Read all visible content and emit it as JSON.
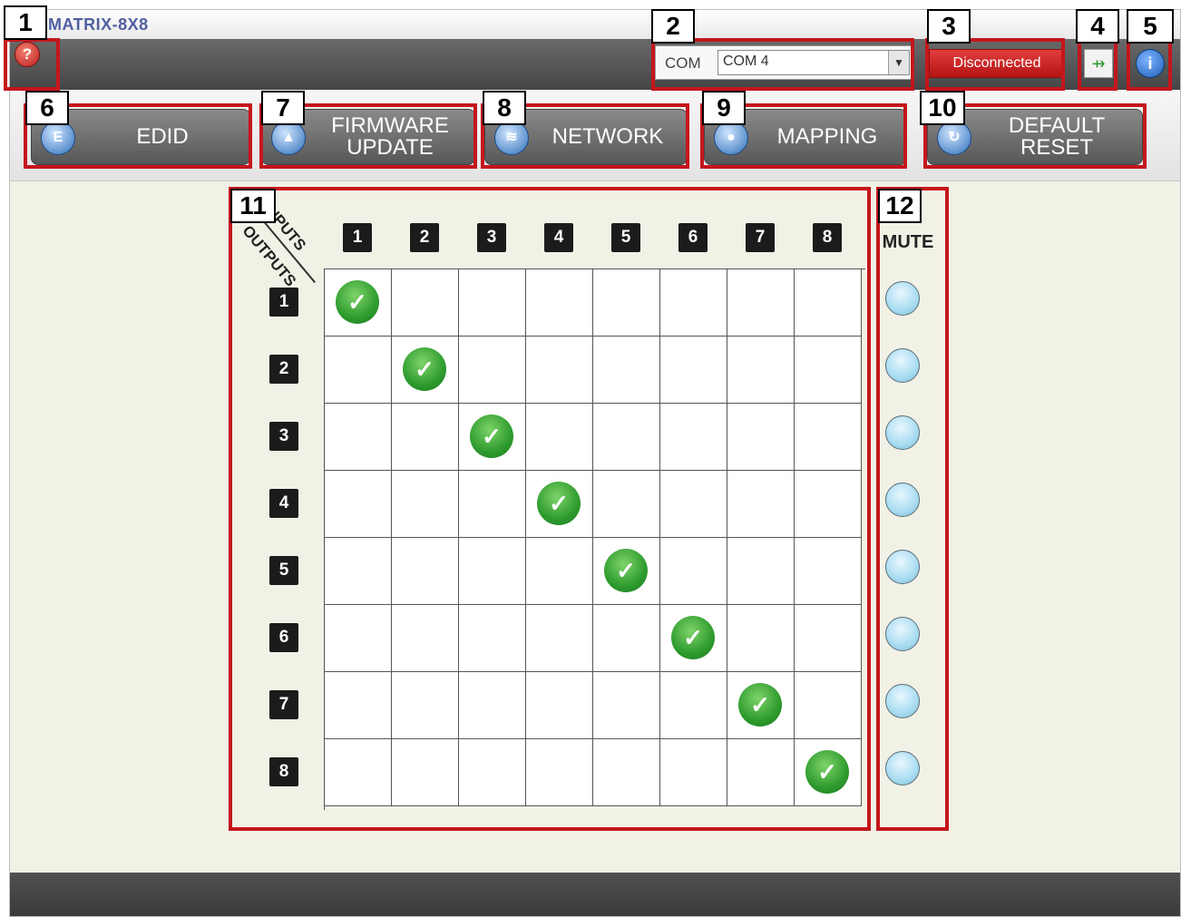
{
  "app": {
    "title": "MATRIX-8X8"
  },
  "toolbar": {
    "help_icon": "question-icon",
    "help_glyph": "?",
    "com_label": "COM",
    "com_value": "COM 4",
    "status": "Disconnected",
    "status_color": "#d42a2a",
    "connect_icon": "plug-icon",
    "connect_glyph": "⇸",
    "info_icon": "info-icon",
    "info_glyph": "i"
  },
  "nav": [
    {
      "label": "EDID",
      "icon": "edid-icon",
      "glyph": "E"
    },
    {
      "label": "FIRMWARE\nUPDATE",
      "icon": "upload-arrow-icon",
      "glyph": "▲"
    },
    {
      "label": "NETWORK",
      "icon": "wifi-icon",
      "glyph": "≋"
    },
    {
      "label": "MAPPING",
      "icon": "map-pin-icon",
      "glyph": "●"
    },
    {
      "label": "DEFAULT\nRESET",
      "icon": "reset-icon",
      "glyph": "↻"
    }
  ],
  "matrix": {
    "inputs_label": "INPUTS",
    "outputs_label": "OUTPUTS",
    "inputs": [
      "1",
      "2",
      "3",
      "4",
      "5",
      "6",
      "7",
      "8"
    ],
    "outputs": [
      "1",
      "2",
      "3",
      "4",
      "5",
      "6",
      "7",
      "8"
    ],
    "routes": [
      1,
      2,
      3,
      4,
      5,
      6,
      7,
      8
    ],
    "check_glyph": "✓",
    "mute_label": "MUTE",
    "mute_states": [
      false,
      false,
      false,
      false,
      false,
      false,
      false,
      false
    ]
  },
  "annotations": [
    "1",
    "2",
    "3",
    "4",
    "5",
    "6",
    "7",
    "8",
    "9",
    "10",
    "11",
    "12"
  ],
  "colors": {
    "annotation_border": "#c4161c",
    "toolbar": "#555555",
    "background": "#f2f1e6"
  }
}
